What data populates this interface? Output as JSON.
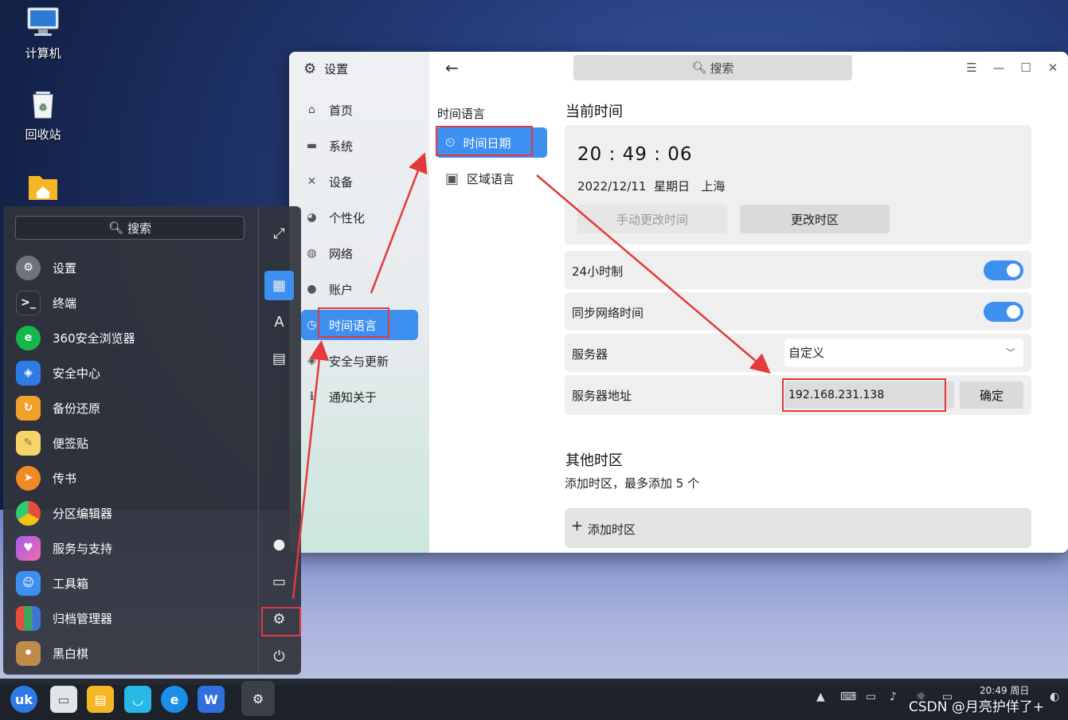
{
  "desktop": {
    "icons": [
      {
        "label": "计算机"
      },
      {
        "label": "回收站"
      },
      {
        "label": ""
      }
    ]
  },
  "settings": {
    "app_title": "设置",
    "search_placeholder": "搜索",
    "nav": [
      {
        "label": "首页"
      },
      {
        "label": "系统"
      },
      {
        "label": "设备"
      },
      {
        "label": "个性化"
      },
      {
        "label": "网络"
      },
      {
        "label": "账户"
      },
      {
        "label": "时间语言"
      },
      {
        "label": "安全与更新"
      },
      {
        "label": "通知关于"
      }
    ],
    "active_nav": "时间语言",
    "sub_title": "时间语言",
    "sub_items": [
      {
        "label": "时间日期"
      },
      {
        "label": "区域语言"
      }
    ],
    "current_time": {
      "title": "当前时间",
      "time": "20 : 49 : 06",
      "date": "2022/12/11",
      "weekday": "星期日",
      "city": "上海",
      "manual_btn": "手动更改时间",
      "timezone_btn": "更改时区"
    },
    "rows": {
      "hour24": "24小时制",
      "sync": "同步网络时间",
      "server_label": "服务器",
      "server_value": "自定义",
      "addr_label": "服务器地址",
      "addr_value": "192.168.231.138",
      "confirm": "确定"
    },
    "other": {
      "title": "其他时区",
      "desc": "添加时区，最多添加 5 个",
      "add": "添加时区"
    }
  },
  "start_menu": {
    "search_placeholder": "搜索",
    "apps": [
      {
        "label": "设置"
      },
      {
        "label": "终端"
      },
      {
        "label": "360安全浏览器"
      },
      {
        "label": "安全中心"
      },
      {
        "label": "备份还原"
      },
      {
        "label": "便签贴"
      },
      {
        "label": "传书"
      },
      {
        "label": "分区编辑器"
      },
      {
        "label": "服务与支持"
      },
      {
        "label": "工具箱"
      },
      {
        "label": "归档管理器"
      },
      {
        "label": "黑白棋"
      }
    ]
  },
  "taskbar": {
    "clock": "20:49 周日",
    "watermark": "CSDN @月亮护佯了+"
  },
  "colors": {
    "accent": "#3d8ff0",
    "annotation": "#e5393b"
  }
}
